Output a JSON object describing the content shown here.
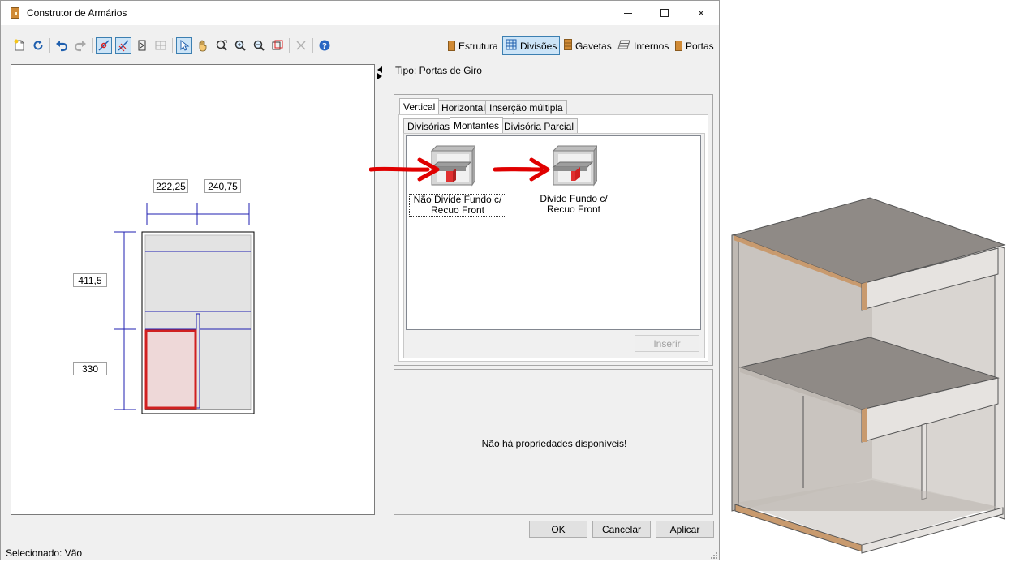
{
  "window": {
    "title": "Construtor de Armários",
    "controls": {
      "minimize": "minimize",
      "maximize": "maximize",
      "close": "×"
    }
  },
  "toolbar": {
    "tabs": [
      {
        "label": "Estrutura",
        "icon": "door-icon"
      },
      {
        "label": "Divisões",
        "icon": "grid-icon",
        "active": true
      },
      {
        "label": "Gavetas",
        "icon": "drawer-icon"
      },
      {
        "label": "Internos",
        "icon": "shelves-icon"
      },
      {
        "label": "Portas",
        "icon": "door-icon"
      }
    ]
  },
  "drawing": {
    "dims": {
      "top_left": "222,25",
      "top_right": "240,75",
      "left_top": "411,5",
      "left_bottom": "330"
    },
    "colors": {
      "dimension": "#1f1fb0",
      "selection": "#e02020",
      "fill": "#e3e3e3"
    }
  },
  "panel": {
    "type_label": "Tipo: Portas de Giro",
    "main_tabs": [
      "Vertical",
      "Horizontal",
      "Inserção múltipla"
    ],
    "sub_tabs": [
      "Divisórias",
      "Montantes",
      "Divisória Parcial"
    ],
    "items": [
      {
        "label_line1": "Não Divide Fundo c/",
        "label_line2": "Recuo Front",
        "selected": true
      },
      {
        "label_line1": "Divide Fundo c/",
        "label_line2": "Recuo Front",
        "selected": false
      }
    ],
    "insert_button": "Inserir",
    "props_empty": "Não há propriedades disponíveis!"
  },
  "buttons": {
    "ok": "OK",
    "cancel": "Cancelar",
    "apply": "Aplicar"
  },
  "status": {
    "text": "Selecionado: Vão"
  },
  "accent_colors": {
    "selection_blue": "#3c7fb1",
    "arrow_red": "#e00000",
    "edge_wood": "#c89a6e"
  }
}
